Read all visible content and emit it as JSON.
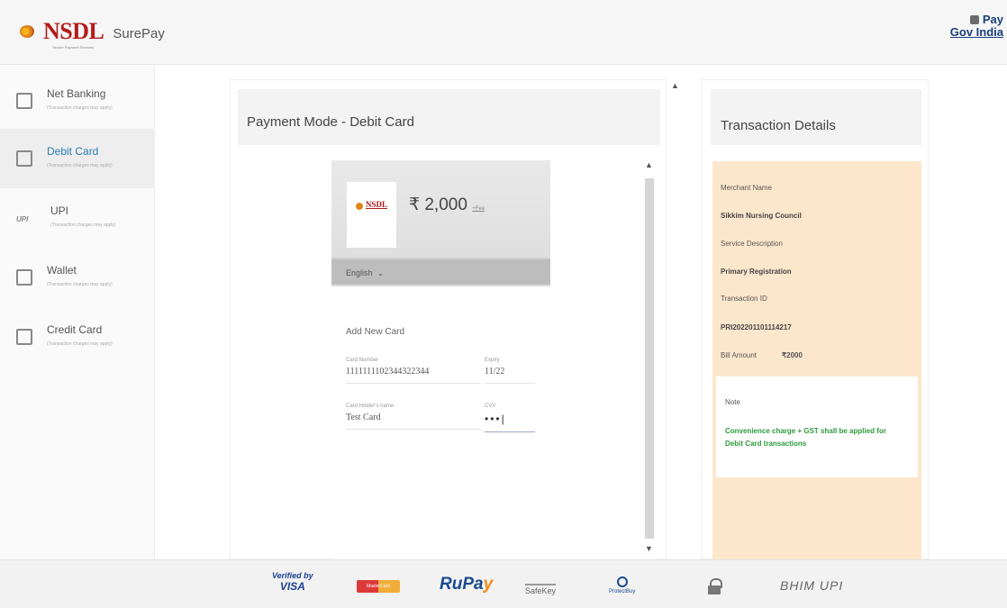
{
  "header": {
    "brand": "NSDL",
    "product": "SurePay",
    "tagline": "Secure Payment Services",
    "paygov_line1": "Pay",
    "paygov_line2": "Gov India"
  },
  "sidebar": {
    "items": [
      {
        "label": "Net Banking",
        "sub": "(Transaction charges may apply)",
        "icon": "bank-icon",
        "active": false
      },
      {
        "label": "Debit Card",
        "sub": "(Transaction charges may apply)",
        "icon": "debit-card-icon",
        "active": true
      },
      {
        "label": "UPI",
        "sub": "(Transaction charges may apply)",
        "icon": "upi-icon",
        "icon_text": "UPI",
        "active": false
      },
      {
        "label": "Wallet",
        "sub": "(Transaction charges may apply)",
        "icon": "wallet-icon",
        "active": false
      },
      {
        "label": "Credit Card",
        "sub": "(Transaction charges may apply)",
        "icon": "credit-card-icon",
        "active": false
      }
    ]
  },
  "center": {
    "title": "Payment Mode - Debit Card",
    "merchant_logo_text": "NSDL",
    "amount": "₹ 2,000",
    "fee_link": "+Fee",
    "language": "English",
    "add_card_label": "Add New Card",
    "card_number_label": "Card Number",
    "card_number_value": "1111111102344322344",
    "expiry_label": "Expiry",
    "expiry_value": "11/22",
    "holder_label": "Card Holder's name",
    "holder_value": "Test Card",
    "cvv_label": "CVV",
    "cvv_value": "•••|"
  },
  "details": {
    "title": "Transaction Details",
    "merchant_name_label": "Merchant Name",
    "merchant_name": "Sikkim Nursing Council",
    "service_label": "Service Description",
    "service": "Primary Registration",
    "txn_label": "Transaction ID",
    "txn_id": "PRI202201101114217",
    "bill_label": "Bill Amount",
    "bill_amount": "₹2000",
    "note_label": "Note",
    "note_text": "Convenience charge + GST shall be applied for Debit Card transactions"
  },
  "footer": {
    "visa_top": "Verified by",
    "visa_bottom": "VISA",
    "mastercard": "MasterCard",
    "rupay_a": "RuPa",
    "rupay_b": "y",
    "safekey": "SafeKey",
    "diners": "ProtectBuy",
    "bhim": "BHIM UPI"
  },
  "colors": {
    "accent": "#2a7db3",
    "details_bg": "#fde7cc",
    "note_green": "#2e9b3b",
    "brand_red": "#b31b1b"
  }
}
